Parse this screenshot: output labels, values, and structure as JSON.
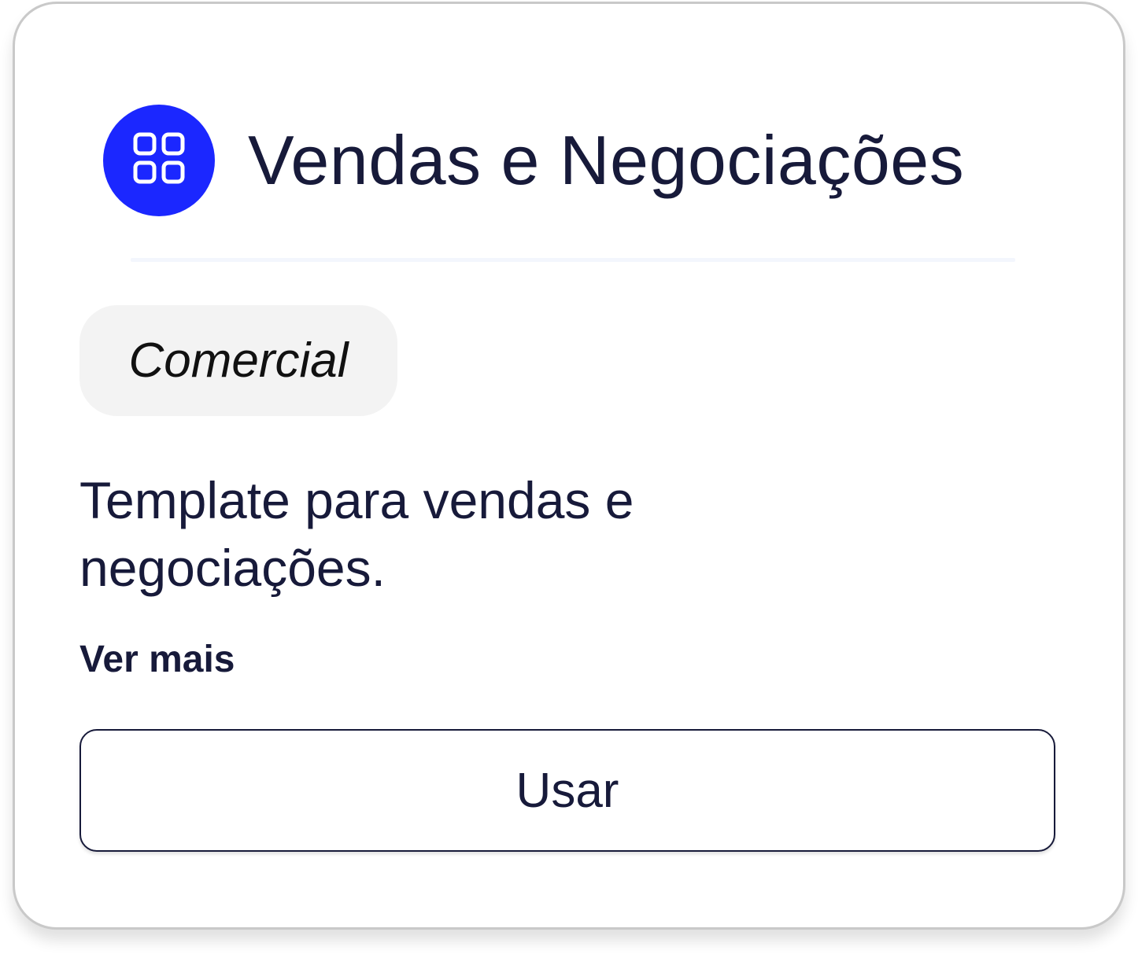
{
  "card": {
    "icon": "grid-icon",
    "icon_bg_color": "#1b27ff",
    "title": "Vendas e Negociações",
    "tag": "Comercial",
    "description": "Template para vendas e negociações.",
    "more_label": "Ver mais",
    "use_label": "Usar"
  }
}
